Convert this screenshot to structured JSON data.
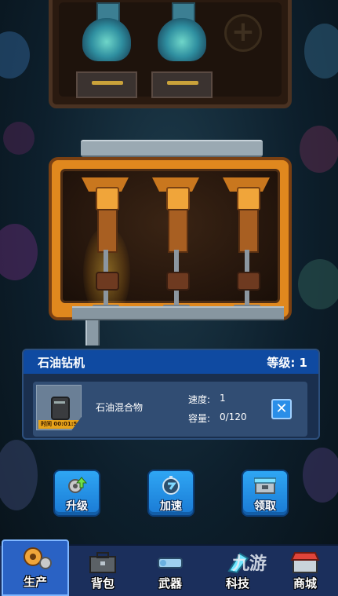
{
  "info_card": {
    "title": "石油钻机",
    "level_label": "等级: 1",
    "product_name": "石油混合物",
    "timer": "时间 00:01:57",
    "speed_label": "速度:",
    "speed_value": "1",
    "capacity_label": "容量:",
    "capacity_value": "0/120"
  },
  "actions": {
    "upgrade": "升级",
    "speedup": "加速",
    "collect": "领取"
  },
  "nav": {
    "production": "生产",
    "backpack": "背包",
    "weapons": "武器",
    "tech": "科技",
    "shop": "商城"
  },
  "watermark": "九游",
  "colors": {
    "panel_orange": "#e0881e",
    "card_header_blue": "#0f4aa1",
    "button_blue": "#2fa6f4",
    "nav_bg": "#1b2f5c"
  }
}
